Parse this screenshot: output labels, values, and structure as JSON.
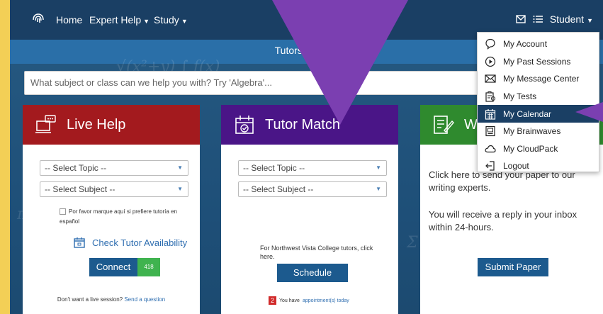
{
  "nav": {
    "home": "Home",
    "expert_help": "Expert Help",
    "study": "Study",
    "student": "Student"
  },
  "banner": {
    "text": "Tutors are ava"
  },
  "search": {
    "placeholder": "What subject or class can we help you with? Try 'Algebra'..."
  },
  "live_help": {
    "title": "Live Help",
    "select_topic": "-- Select Topic --",
    "select_subject": "-- Select Subject --",
    "spanish_checkbox": "Por favor marque aquí si prefiere tutoría en español",
    "check_availability": "Check Tutor Availability",
    "connect": "Connect",
    "connect_count": "418",
    "footer_text": "Don't want a live session?",
    "footer_link": "Send a question"
  },
  "tutor_match": {
    "title": "Tutor Match",
    "select_topic": "-- Select Topic --",
    "select_subject": "-- Select Subject --",
    "nvc_text": "For Northwest Vista College tutors, click here.",
    "schedule": "Schedule",
    "appt_count": "2",
    "appt_text": "You have",
    "appt_link": "appointment(s) today"
  },
  "writing": {
    "title_partial": "W",
    "line1": "Click here to send your paper to our writing experts.",
    "line2": "You will receive a reply in your inbox within 24-hours.",
    "submit": "Submit Paper"
  },
  "dropdown": {
    "items": [
      {
        "label": "My Account",
        "icon": "speech-bubble-icon"
      },
      {
        "label": "My Past Sessions",
        "icon": "play-circle-icon"
      },
      {
        "label": "My Message Center",
        "icon": "envelope-icon"
      },
      {
        "label": "My Tests",
        "icon": "test-clipboard-icon"
      },
      {
        "label": "My Calendar",
        "icon": "calendar-icon"
      },
      {
        "label": "My Brainwaves",
        "icon": "brainwaves-icon"
      },
      {
        "label": "My CloudPack",
        "icon": "cloud-icon"
      },
      {
        "label": "Logout",
        "icon": "logout-icon"
      }
    ],
    "active_item": "My Calendar"
  },
  "colors": {
    "live_help_head": "#a31a1e",
    "tutor_match_head": "#4a1587",
    "writing_head": "#2f8a2e",
    "arrow": "#7b3fb1",
    "frame_bg": "#f3cf56",
    "connect_badge": "#3fb34f"
  }
}
